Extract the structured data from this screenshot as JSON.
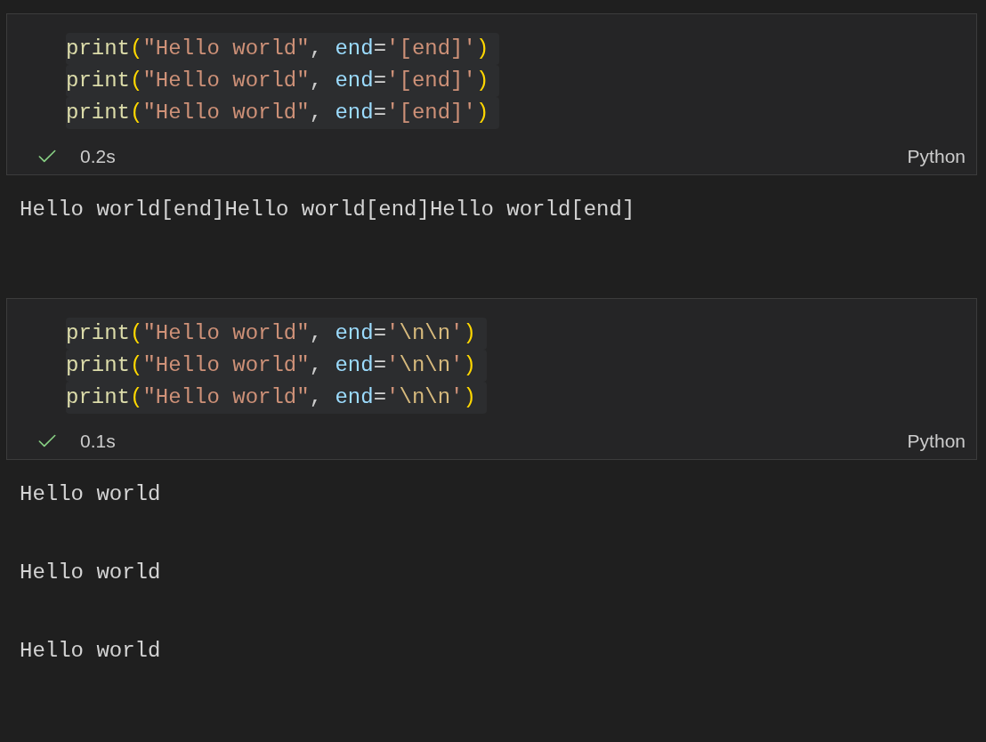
{
  "cells": [
    {
      "code": [
        [
          {
            "kind": "function",
            "text": "print"
          },
          {
            "kind": "paren",
            "text": "("
          },
          {
            "kind": "string",
            "text": "\"Hello world\""
          },
          {
            "kind": "punct",
            "text": ", "
          },
          {
            "kind": "param",
            "text": "end"
          },
          {
            "kind": "operator",
            "text": "="
          },
          {
            "kind": "string",
            "text": "'[end]'"
          },
          {
            "kind": "paren",
            "text": ")"
          }
        ],
        [
          {
            "kind": "function",
            "text": "print"
          },
          {
            "kind": "paren",
            "text": "("
          },
          {
            "kind": "string",
            "text": "\"Hello world\""
          },
          {
            "kind": "punct",
            "text": ", "
          },
          {
            "kind": "param",
            "text": "end"
          },
          {
            "kind": "operator",
            "text": "="
          },
          {
            "kind": "string",
            "text": "'[end]'"
          },
          {
            "kind": "paren",
            "text": ")"
          }
        ],
        [
          {
            "kind": "function",
            "text": "print"
          },
          {
            "kind": "paren",
            "text": "("
          },
          {
            "kind": "string",
            "text": "\"Hello world\""
          },
          {
            "kind": "punct",
            "text": ", "
          },
          {
            "kind": "param",
            "text": "end"
          },
          {
            "kind": "operator",
            "text": "="
          },
          {
            "kind": "string",
            "text": "'[end]'"
          },
          {
            "kind": "paren",
            "text": ")"
          }
        ]
      ],
      "succeeded": true,
      "duration": "0.2s",
      "language": "Python",
      "output": "Hello world[end]Hello world[end]Hello world[end]"
    },
    {
      "code": [
        [
          {
            "kind": "function",
            "text": "print"
          },
          {
            "kind": "paren",
            "text": "("
          },
          {
            "kind": "string",
            "text": "\"Hello world\""
          },
          {
            "kind": "punct",
            "text": ", "
          },
          {
            "kind": "param",
            "text": "end"
          },
          {
            "kind": "operator",
            "text": "="
          },
          {
            "kind": "string",
            "text": "'"
          },
          {
            "kind": "escape",
            "text": "\\n\\n"
          },
          {
            "kind": "string",
            "text": "'"
          },
          {
            "kind": "paren",
            "text": ")"
          }
        ],
        [
          {
            "kind": "function",
            "text": "print"
          },
          {
            "kind": "paren",
            "text": "("
          },
          {
            "kind": "string",
            "text": "\"Hello world\""
          },
          {
            "kind": "punct",
            "text": ", "
          },
          {
            "kind": "param",
            "text": "end"
          },
          {
            "kind": "operator",
            "text": "="
          },
          {
            "kind": "string",
            "text": "'"
          },
          {
            "kind": "escape",
            "text": "\\n\\n"
          },
          {
            "kind": "string",
            "text": "'"
          },
          {
            "kind": "paren",
            "text": ")"
          }
        ],
        [
          {
            "kind": "function",
            "text": "print"
          },
          {
            "kind": "paren",
            "text": "("
          },
          {
            "kind": "string",
            "text": "\"Hello world\""
          },
          {
            "kind": "punct",
            "text": ", "
          },
          {
            "kind": "param",
            "text": "end"
          },
          {
            "kind": "operator",
            "text": "="
          },
          {
            "kind": "string",
            "text": "'"
          },
          {
            "kind": "escape",
            "text": "\\n\\n"
          },
          {
            "kind": "string",
            "text": "'"
          },
          {
            "kind": "paren",
            "text": ")"
          }
        ]
      ],
      "succeeded": true,
      "duration": "0.1s",
      "language": "Python",
      "output": "Hello world\n\nHello world\n\nHello world"
    }
  ]
}
